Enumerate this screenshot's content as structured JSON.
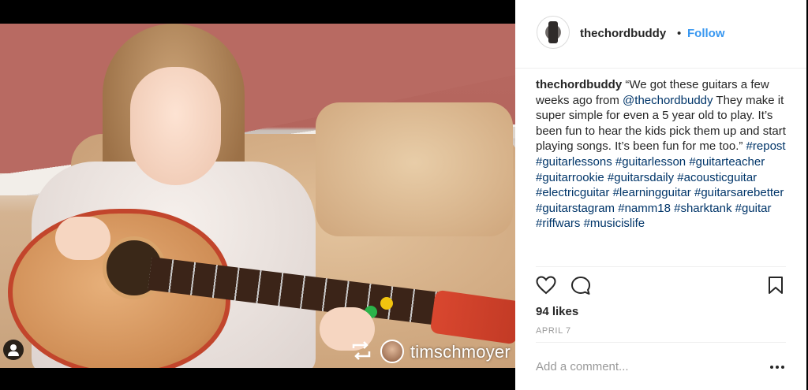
{
  "post": {
    "username": "thechordbuddy",
    "separator": "•",
    "follow_label": "Follow",
    "caption": {
      "username": "thechordbuddy",
      "text_before_mention": "“We got these guitars a few weeks ago from ",
      "mention": "@thechordbuddy",
      "text_after_mention": " They make it super simple for even a 5 year old to play. It’s been fun to hear the kids pick them up and start playing songs. It’s been fun for me too.” ",
      "hashtags": [
        "#repost",
        "#guitarlessons",
        "#guitarlesson",
        "#guitarteacher",
        "#guitarrookie",
        "#guitarsdaily",
        "#acousticguitar",
        "#electricguitar",
        "#learningguitar",
        "#guitarsarebetter",
        "#guitarstagram",
        "#namm18",
        "#sharktank",
        "#guitar",
        "#riffwars",
        "#musicislife"
      ]
    },
    "likes": "94 likes",
    "date": "APRIL 7",
    "comment_placeholder": "Add a comment...",
    "photo_watermark": "timschmoyer"
  },
  "icons": {
    "like": "heart-icon",
    "comment": "comment-bubble-icon",
    "save": "bookmark-icon",
    "more": "more-options-icon",
    "tagged_users": "user-tag-icon",
    "repost": "repost-icon"
  },
  "colors": {
    "link": "#003569",
    "follow": "#3897f0",
    "text": "#262626",
    "muted": "#999999"
  }
}
